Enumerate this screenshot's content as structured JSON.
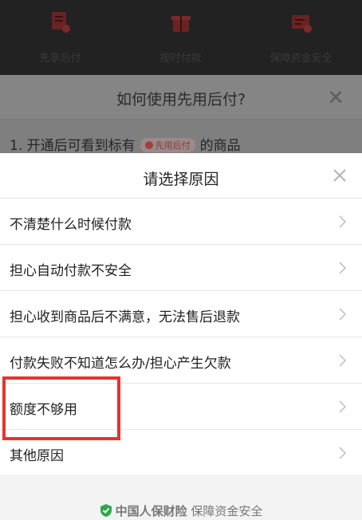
{
  "background": {
    "features": [
      {
        "label": "先享后付",
        "icon": "voucher-icon"
      },
      {
        "label": "按时付款",
        "icon": "gift-icon"
      },
      {
        "label": "保障资金安全",
        "icon": "ticket-icon"
      }
    ],
    "info_title": "如何使用先用后付?",
    "step_prefix": "1. 开通后可看到标有",
    "badge_text": "先用后付",
    "step_suffix": "的商品"
  },
  "sheet": {
    "title": "请选择原因",
    "reasons": [
      "不清楚什么时候付款",
      "担心自动付款不安全",
      "担心收到商品后不满意，无法售后退款",
      "付款失败不知道怎么办/担心产生欠款",
      "额度不够用",
      "其他原因"
    ]
  },
  "footer": {
    "insurer": "中国人保财险",
    "guarantee": "保障资金安全"
  },
  "colors": {
    "highlight": "#e8322e",
    "shield": "#2fa84f"
  }
}
